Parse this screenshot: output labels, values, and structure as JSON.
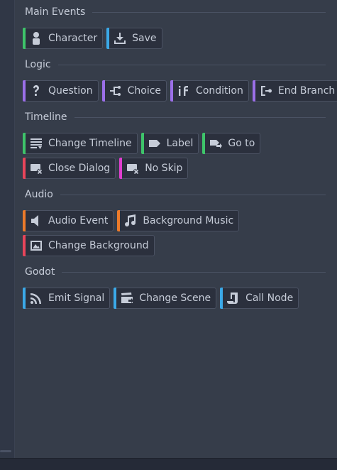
{
  "colors": {
    "character_stripe": "#3ec46a",
    "save_stripe": "#3ba9e8",
    "logic_stripe": "#9b6fe8",
    "timeline_stripe": "#3ec46a",
    "close_dialog_stripe": "#e8455a",
    "no_skip_stripe": "#e03ecf",
    "audio_stripe": "#ec7a2a",
    "background_stripe": "#e8455a",
    "godot_stripe": "#3ba9e8"
  },
  "sections": {
    "main_events": {
      "title": "Main Events",
      "buttons": [
        {
          "label": "Character",
          "icon": "character-icon"
        },
        {
          "label": "Save",
          "icon": "save-icon"
        }
      ]
    },
    "logic": {
      "title": "Logic",
      "buttons": [
        {
          "label": "Question",
          "icon": "question-icon"
        },
        {
          "label": "Choice",
          "icon": "choice-icon"
        },
        {
          "label": "Condition",
          "icon": "condition-icon"
        },
        {
          "label": "End Branch",
          "icon": "end-branch-icon"
        }
      ]
    },
    "timeline": {
      "title": "Timeline",
      "buttons": [
        {
          "label": "Change Timeline",
          "icon": "change-timeline-icon"
        },
        {
          "label": "Label",
          "icon": "label-icon"
        },
        {
          "label": "Go to",
          "icon": "goto-icon"
        },
        {
          "label": "Close Dialog",
          "icon": "close-dialog-icon"
        },
        {
          "label": "No Skip",
          "icon": "no-skip-icon"
        }
      ]
    },
    "audio": {
      "title": "Audio",
      "buttons": [
        {
          "label": "Audio Event",
          "icon": "audio-event-icon"
        },
        {
          "label": "Background Music",
          "icon": "music-icon"
        },
        {
          "label": "Change Background",
          "icon": "background-image-icon"
        }
      ]
    },
    "godot": {
      "title": "Godot",
      "buttons": [
        {
          "label": "Emit Signal",
          "icon": "signal-icon"
        },
        {
          "label": "Change Scene",
          "icon": "scene-icon"
        },
        {
          "label": "Call Node",
          "icon": "call-node-icon"
        }
      ]
    }
  }
}
